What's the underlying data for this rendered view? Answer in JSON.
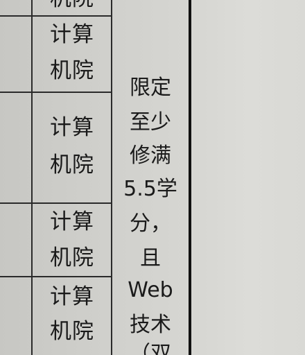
{
  "table": {
    "rows": [
      {
        "dept": "机院"
      },
      {
        "dept_line1": "计算",
        "dept_line2": "机院"
      },
      {
        "dept_line1": "计算",
        "dept_line2": "机院"
      },
      {
        "dept_line1": "计算",
        "dept_line2": "机院"
      },
      {
        "dept_line1": "计算",
        "dept_line2": "机院"
      }
    ],
    "note_lines": [
      "限定",
      "至少",
      "修满",
      "5.5学",
      "分，",
      "且",
      "Web",
      "技术",
      "（双"
    ]
  }
}
